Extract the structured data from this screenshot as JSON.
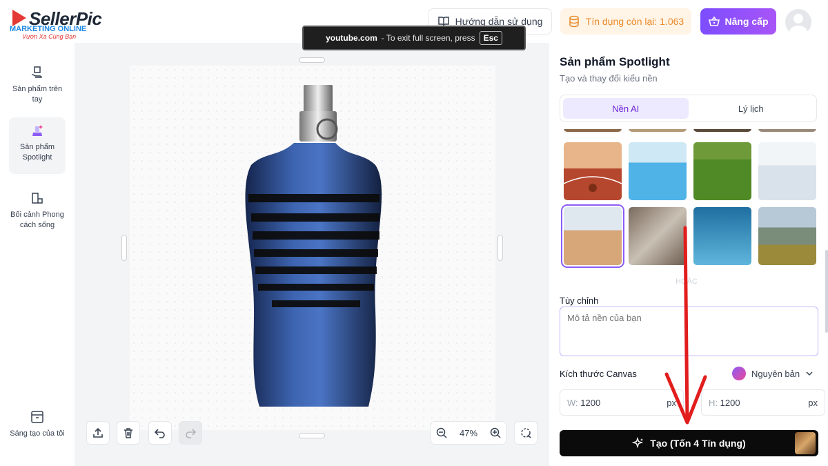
{
  "brand": {
    "name": "SellerPic",
    "watermark_line1": "MARKETING ONLINE",
    "watermark_line2": "Vươn Xa Cùng Bạn"
  },
  "topbar": {
    "guide_label": "Hướng dẫn sử dụng",
    "credits_label": "Tín dụng còn lại: 1.063",
    "upgrade_label": "Nâng cấp"
  },
  "fullscreen_toast": {
    "site": "youtube.com",
    "message": "-  To exit full screen, press",
    "key": "Esc"
  },
  "sidebar": {
    "items": [
      {
        "label": "Sản phẩm trên tay",
        "icon": "hand-product-icon"
      },
      {
        "label": "Sản phẩm Spotlight",
        "icon": "spotlight-icon"
      },
      {
        "label": "Bối cảnh Phong cách sống",
        "icon": "lifestyle-icon"
      },
      {
        "label": "Sáng tạo của tôi",
        "icon": "archive-icon"
      }
    ]
  },
  "canvas": {
    "zoom": "47%"
  },
  "panel": {
    "title": "Sản phẩm Spotlight",
    "subtitle": "Tạo và thay đổi kiểu nền",
    "tabs": [
      {
        "label": "Nền AI",
        "active": true
      },
      {
        "label": "Lý lịch",
        "active": false
      }
    ],
    "backgrounds": [
      {
        "name": "basketball-court",
        "selected": false
      },
      {
        "name": "pool",
        "selected": false
      },
      {
        "name": "grass",
        "selected": false
      },
      {
        "name": "snow",
        "selected": false
      },
      {
        "name": "desert-dunes",
        "selected": true
      },
      {
        "name": "rocks",
        "selected": false
      },
      {
        "name": "underwater",
        "selected": false
      },
      {
        "name": "mountains",
        "selected": false
      }
    ],
    "or_label": "HOẶC",
    "custom_label": "Tùy chỉnh",
    "custom_placeholder": "Mô tả nền của bạn",
    "canvas_size_label": "Kích thước Canvas",
    "size_option": "Nguyên bản",
    "width_key": "W:",
    "width_value": "1200",
    "height_key": "H:",
    "height_value": "1200",
    "unit": "px",
    "generate_label": "Tạo (Tốn 4 Tín dụng)"
  },
  "colors": {
    "accent": "#8b5cf6",
    "credit": "#ea8a2a",
    "arrow": "#e11d1d"
  }
}
